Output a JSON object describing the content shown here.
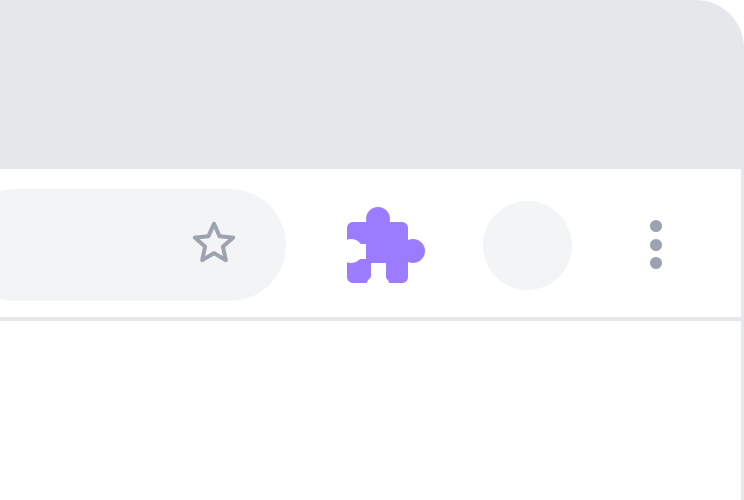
{
  "window": {
    "title": ""
  },
  "toolbar": {
    "address_bar": {
      "value": "",
      "placeholder": ""
    },
    "bookmark_icon": "star-outline-icon",
    "extensions_icon": "puzzle-piece-icon",
    "avatar_icon": "profile-avatar",
    "menu_icon": "three-vertical-dots-icon"
  },
  "colors": {
    "tab_strip": "#e5e7eb",
    "toolbar": "#ffffff",
    "address_bar": "#f3f4f6",
    "bookmark_icon": "#9ca3af",
    "extensions_icon": "#9b7cff",
    "avatar": "#f3f4f6",
    "menu_icon": "#9ca3af",
    "divider": "#e5e7eb"
  }
}
